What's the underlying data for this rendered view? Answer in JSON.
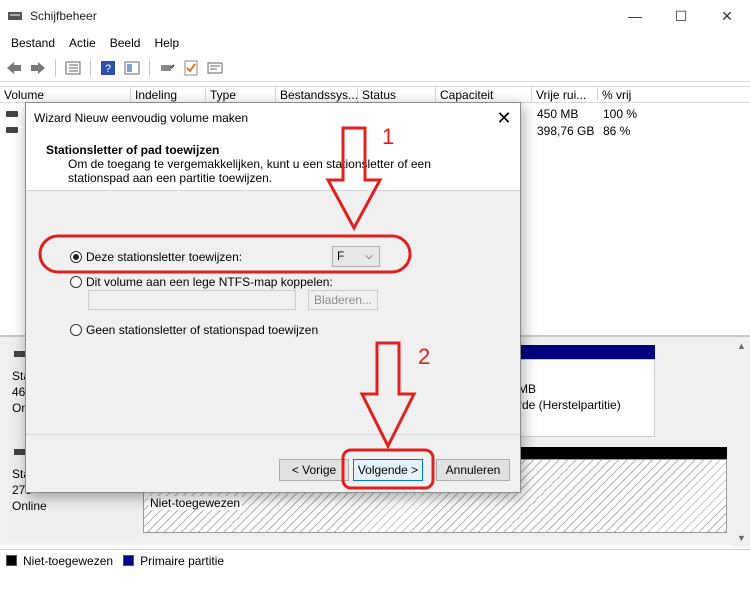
{
  "window": {
    "title": "Schijfbeheer",
    "minimize": "—",
    "maximize": "☐",
    "close": "✕"
  },
  "menu": [
    "Bestand",
    "Actie",
    "Beeld",
    "Help"
  ],
  "list": {
    "columns": [
      "Volume",
      "Indeling",
      "Type",
      "Bestandssys...",
      "Status",
      "Capaciteit",
      "Vrije rui...",
      "% vrij"
    ],
    "rows": [
      {
        "free": "450 MB",
        "percent": "100 %"
      },
      {
        "free": "398,76 GB",
        "percent": "86 %"
      }
    ]
  },
  "lower": {
    "disk1": {
      "line1": "Sta",
      "line2": "465",
      "line3": "Onl"
    },
    "disk1_partition": {
      "size_fragment": "MB",
      "desc_fragment": "rde (Herstelpartitie)"
    },
    "disk2": {
      "line1": "Sta",
      "line2": "279",
      "line3": "Online"
    },
    "disk2_partition": "Niet-toegewezen"
  },
  "legend": {
    "unallocated": "Niet-toegewezen",
    "primary": "Primaire partitie",
    "colors": {
      "unallocated": "#000000",
      "primary": "#000080"
    }
  },
  "dialog": {
    "title": "Wizard Nieuw eenvoudig volume maken",
    "close": "✕",
    "heading": "Stationsletter of pad toewijzen",
    "description": "Om de toegang te vergemakkelijken, kunt u een stationsletter of een stationspad aan een partitie toewijzen.",
    "option_letter": "Deze stationsletter toewijzen:",
    "option_folder": "Dit volume aan een lege NTFS-map koppelen:",
    "option_none": "Geen stationsletter of stationspad toewijzen",
    "selected_letter": "F",
    "browse": "Bladeren...",
    "back": "< Vorige",
    "next": "Volgende >",
    "cancel": "Annuleren"
  },
  "annotations": {
    "step1": "1",
    "step2": "2",
    "color": "#e02020"
  }
}
